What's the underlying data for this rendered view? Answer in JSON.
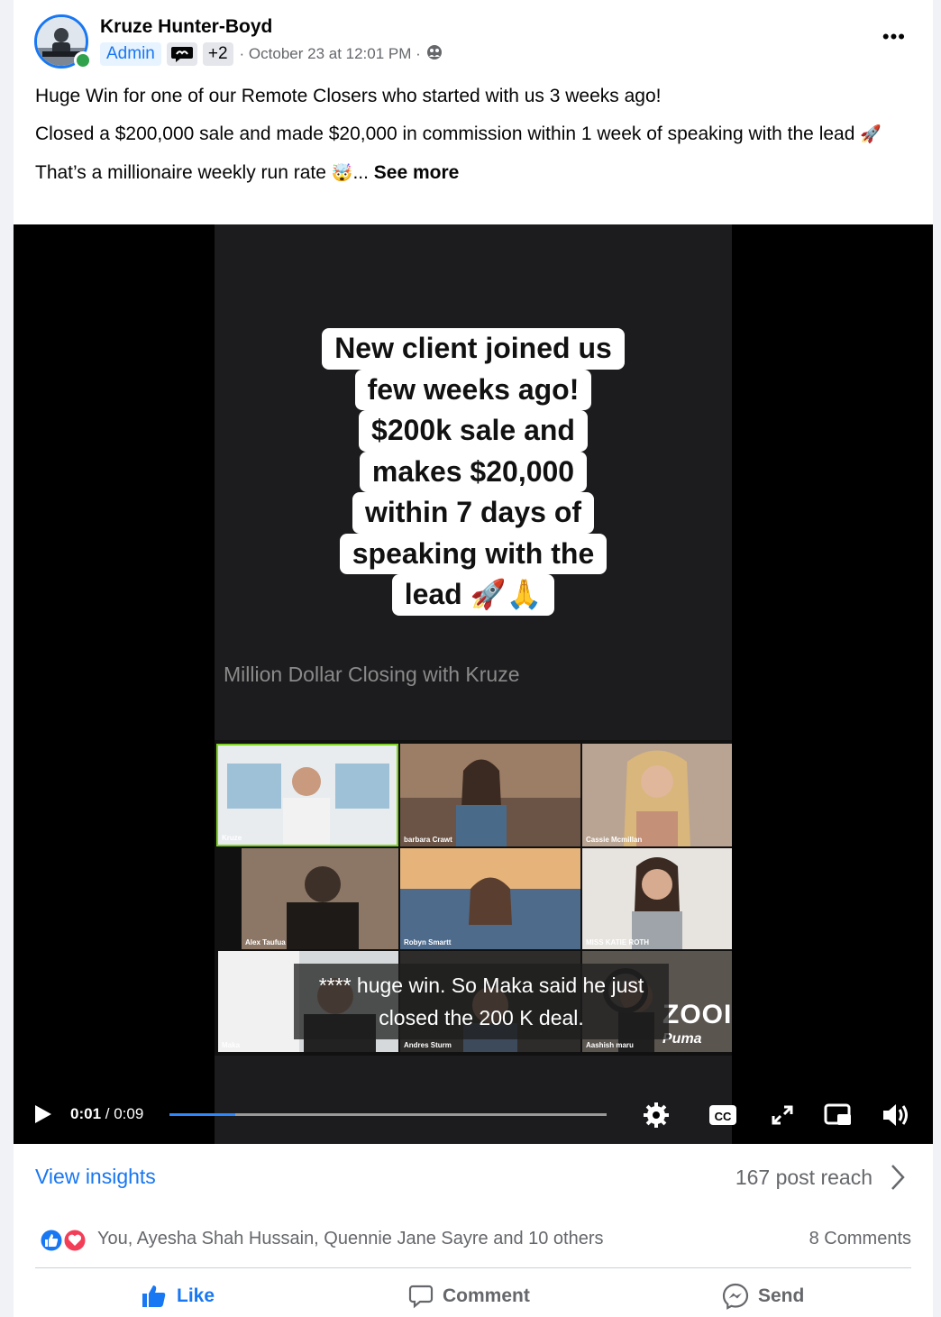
{
  "post": {
    "author": "Kruze Hunter-Boyd",
    "badge_admin": "Admin",
    "badge_extra": "+2",
    "timestamp": "· October 23 at 12:01 PM ·",
    "more_label": "•••",
    "body": [
      "Huge Win for one of our Remote Closers who started with us 3 weeks ago!",
      "Closed a $200,000 sale and made $20,000 in commission within 1 week of speaking with the lead",
      "That’s a millionaire weekly run rate"
    ],
    "body_emoji_1": "🚀",
    "body_emoji_2": "🤯",
    "ellipsis": "...",
    "see_more": "See more"
  },
  "video": {
    "caption_lines": [
      "New client joined us",
      "few weeks ago!",
      "$200k sale and",
      "makes $20,000",
      "within 7 days of",
      "speaking with the",
      "lead 🚀🙏"
    ],
    "session_title": "Million Dollar Closing with Kruze",
    "participants": [
      "Kruze",
      "barbara Crawt",
      "Cassie Mcmillan",
      "Alex Taufua",
      "Robyn Smartt",
      "MISS KATIE ROTH",
      "Maka",
      "Andres Sturm",
      "Aashish maru"
    ],
    "subtitle": "**** huge win. So Maka said he just closed the 200 K deal.",
    "watermark_1": "ZOOI",
    "watermark_2": "Puma",
    "time_current": "0:01",
    "time_sep": " / ",
    "time_total": "0:09",
    "progress": 0.15,
    "icons": [
      "settings-icon",
      "closed-captions-icon",
      "fullscreen-icon",
      "picture-in-picture-icon",
      "volume-icon"
    ]
  },
  "footer": {
    "view_insights": "View insights",
    "post_reach": "167 post reach",
    "reaction_names": "You, Ayesha Shah Hussain, Quennie Jane Sayre and 10 others",
    "comments_count": "8 Comments",
    "like_label": "Like",
    "comment_label": "Comment",
    "send_label": "Send"
  },
  "colors": {
    "brand_blue": "#1877f2",
    "secondary_text": "#65676b",
    "online_green": "#31a24c",
    "progress_blue": "#2d88ff",
    "love_red": "#f33e58"
  }
}
